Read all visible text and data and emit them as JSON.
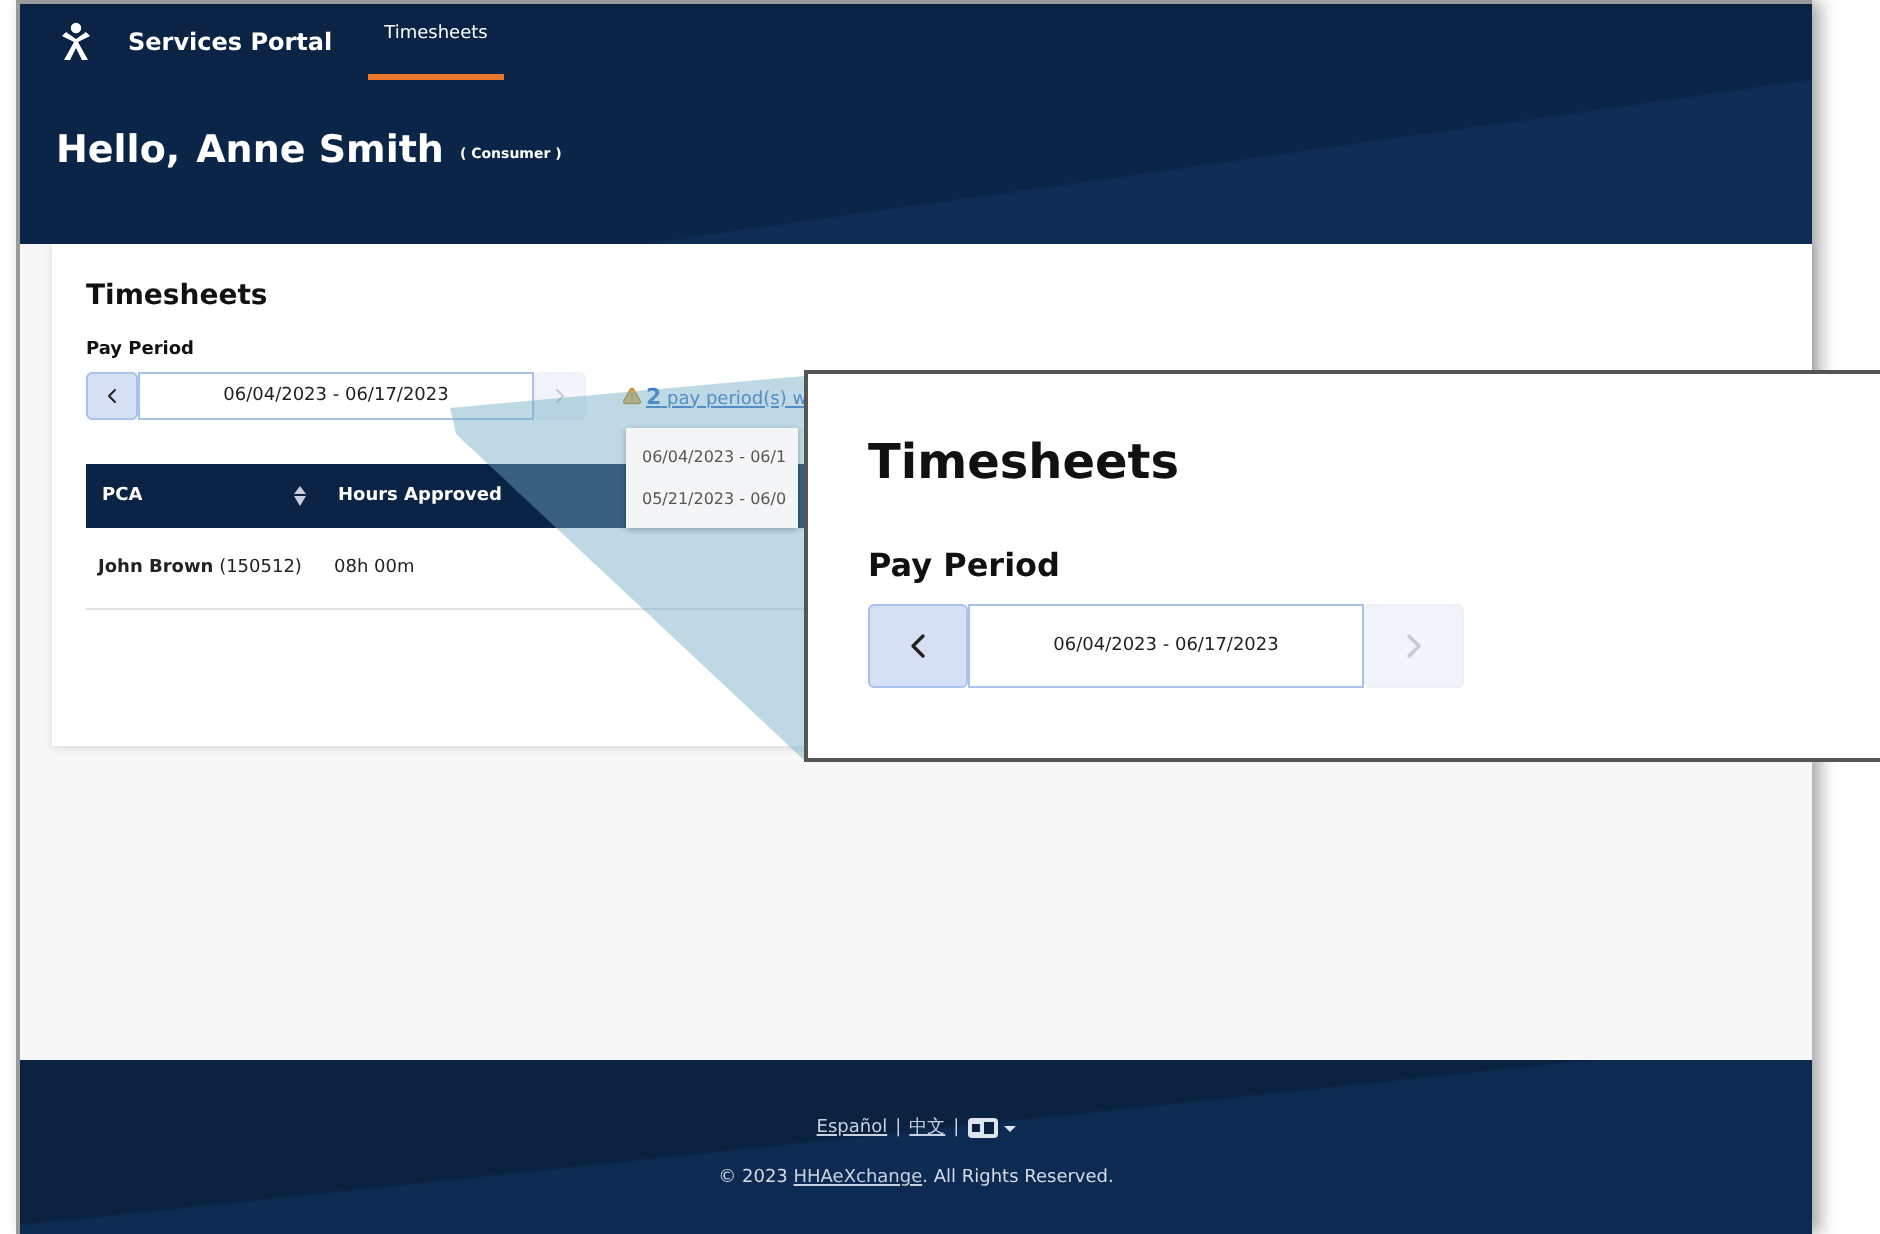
{
  "nav": {
    "brand": "Services Portal",
    "tabs": [
      {
        "label": "Timesheets",
        "selected": true
      }
    ]
  },
  "greeting": {
    "hello": "Hello,",
    "name": "Anne Smith",
    "role": "( Consumer )"
  },
  "timesheets": {
    "title": "Timesheets",
    "pay_period_label": "Pay Period",
    "period": "06/04/2023 - 06/17/2023",
    "prev_disabled": false,
    "next_disabled": true,
    "warning_link": {
      "count": "2",
      "text": "pay period(s) w"
    },
    "dropdown": [
      "06/04/2023 - 06/1",
      "05/21/2023 - 06/0"
    ],
    "table": {
      "columns": [
        "PCA",
        "Hours Approved"
      ],
      "rows": [
        {
          "name": "John Brown",
          "id": "(150512)",
          "hours": "08h 00m"
        }
      ]
    }
  },
  "zoom_inset": {
    "title": "Timesheets",
    "pay_period_label": "Pay Period",
    "period": "06/04/2023 - 06/17/2023",
    "prev_disabled": false,
    "next_disabled": true
  },
  "footer": {
    "languages": [
      "Español",
      "中文"
    ],
    "separator": "|",
    "copyright_before": "© 2023 ",
    "copyright_link": "HHAeXchange",
    "copyright_after": ". All Rights Reserved."
  }
}
